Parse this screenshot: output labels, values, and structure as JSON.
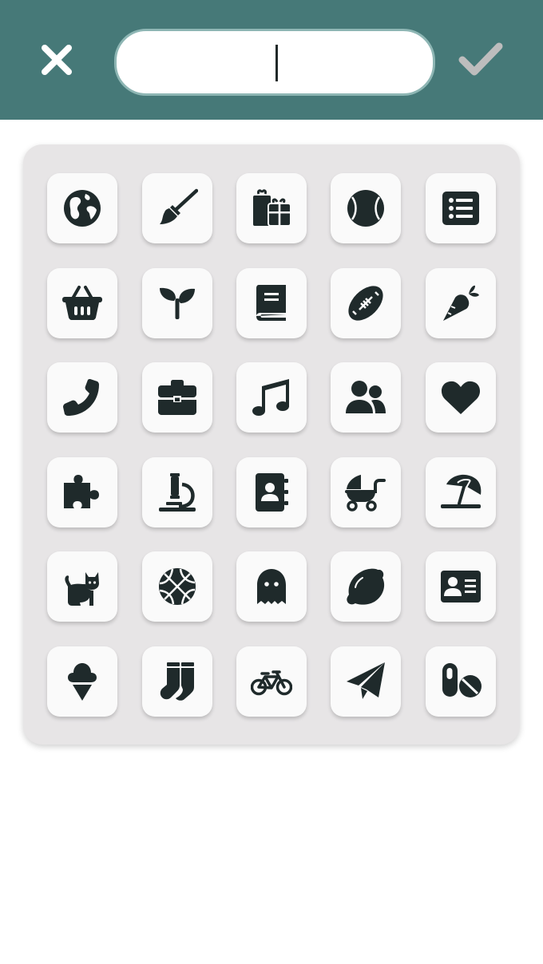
{
  "header": {
    "close_icon": "close-icon",
    "confirm_icon": "check-icon",
    "search": {
      "value": "",
      "placeholder": ""
    }
  },
  "colors": {
    "header_bg": "#467978",
    "search_border": "#8eb6b4",
    "confirm_icon": "#bdbdbd",
    "icon_fill": "#1f2a2b",
    "panel_bg": "#e7e5e6",
    "tile_bg": "#fafafa"
  },
  "icon_grid": {
    "rows": 6,
    "columns": 5,
    "icons": [
      "globe-icon",
      "paintbrush-icon",
      "gifts-icon",
      "baseball-icon",
      "list-icon",
      "basket-icon",
      "seedling-icon",
      "book-icon",
      "football-icon",
      "carrot-icon",
      "phone-icon",
      "briefcase-icon",
      "music-icon",
      "user-group-icon",
      "heart-icon",
      "puzzle-icon",
      "microscope-icon",
      "address-book-icon",
      "baby-carriage-icon",
      "beach-umbrella-icon",
      "cat-icon",
      "basketball-icon",
      "ghost-icon",
      "lemon-icon",
      "id-card-icon",
      "ice-cream-icon",
      "socks-icon",
      "bicycle-icon",
      "paper-plane-icon",
      "pills-icon"
    ]
  }
}
